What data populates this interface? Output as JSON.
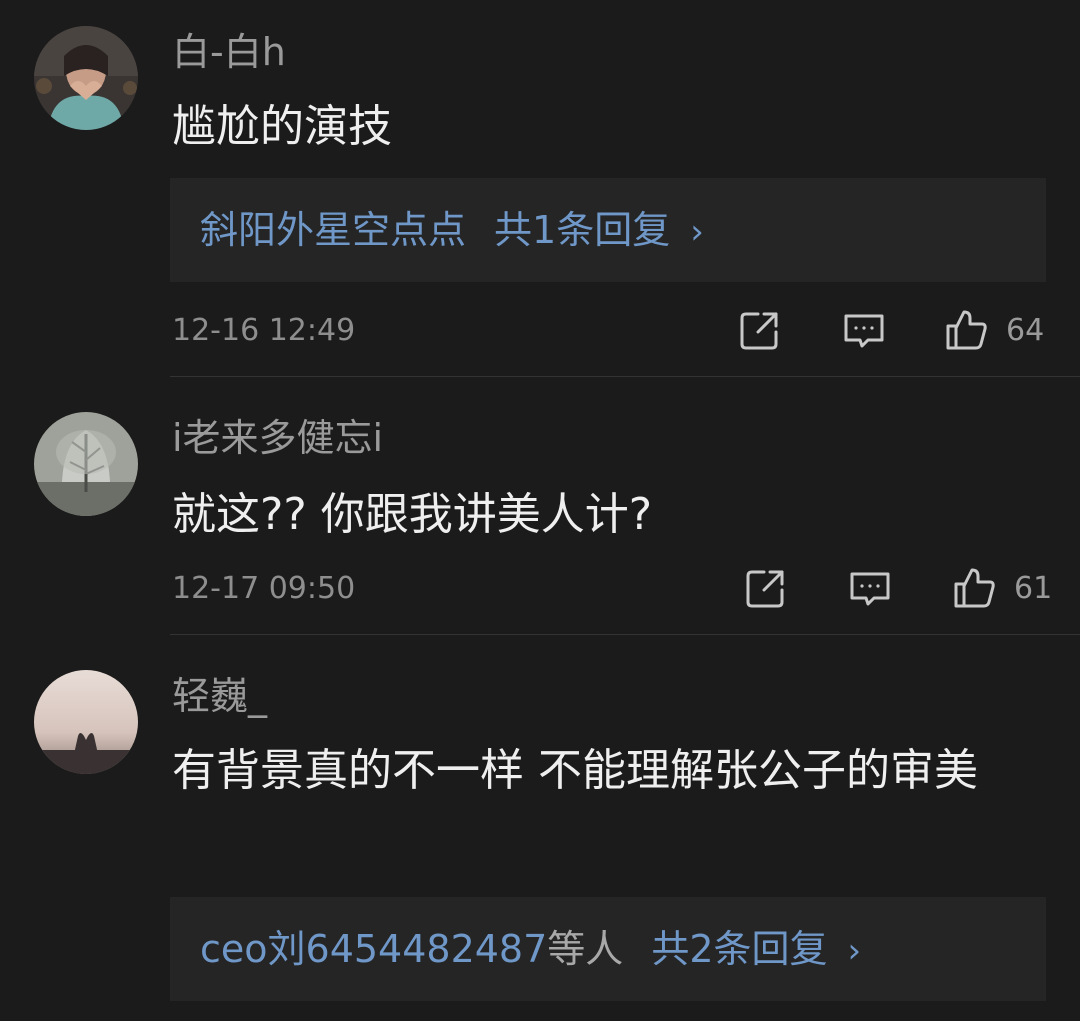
{
  "comments": [
    {
      "username": "白-白h",
      "text": "尴尬的演技",
      "reply": {
        "users": "斜阳外星空点点",
        "suffix": "",
        "count": "共1条回复",
        "chevron": "›"
      },
      "time": "12-16 12:49",
      "likes": "64",
      "avatar": "woman-heart-hands"
    },
    {
      "username": "i老来多健忘i",
      "text": "就这?? 你跟我讲美人计?",
      "time": "12-17 09:50",
      "likes": "61",
      "avatar": "snowy-tree"
    },
    {
      "username": "轻巍_",
      "text": "有背景真的不一样 不能理解张公子的审美",
      "reply": {
        "users": "ceo刘6454482487",
        "suffix": "等人",
        "count": "共2条回复",
        "chevron": "›"
      },
      "avatar": "silhouette-heart-hands"
    }
  ],
  "icons": {
    "share": "share-icon",
    "comment": "comment-icon",
    "like": "thumbs-up-icon"
  },
  "colors": {
    "background": "#1b1b1b",
    "reply_box": "#252525",
    "link": "#6f97c8",
    "username": "#9a9a9a",
    "text": "#efefef"
  }
}
